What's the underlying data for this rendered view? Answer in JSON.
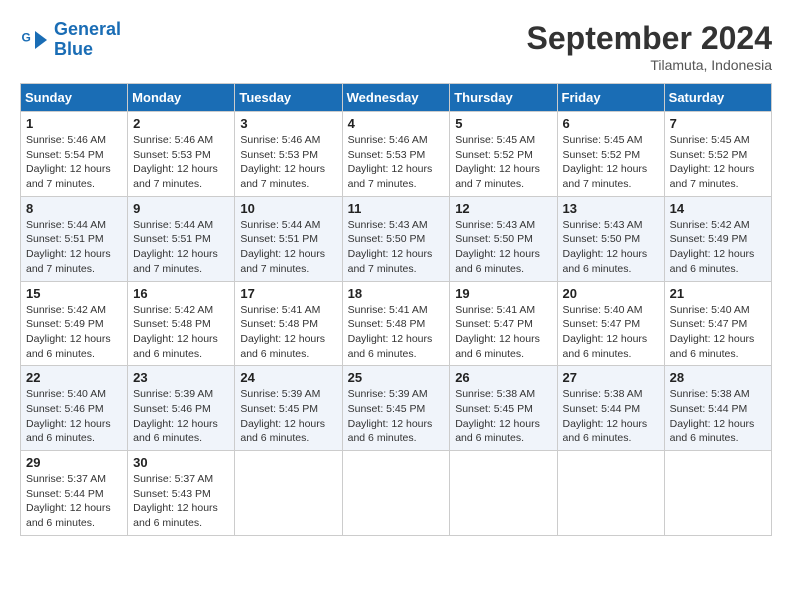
{
  "logo": {
    "line1": "General",
    "line2": "Blue"
  },
  "title": "September 2024",
  "subtitle": "Tilamuta, Indonesia",
  "headers": [
    "Sunday",
    "Monday",
    "Tuesday",
    "Wednesday",
    "Thursday",
    "Friday",
    "Saturday"
  ],
  "weeks": [
    [
      {
        "day": "1",
        "sunrise": "5:46 AM",
        "sunset": "5:54 PM",
        "daylight": "12 hours and 7 minutes."
      },
      {
        "day": "2",
        "sunrise": "5:46 AM",
        "sunset": "5:53 PM",
        "daylight": "12 hours and 7 minutes."
      },
      {
        "day": "3",
        "sunrise": "5:46 AM",
        "sunset": "5:53 PM",
        "daylight": "12 hours and 7 minutes."
      },
      {
        "day": "4",
        "sunrise": "5:46 AM",
        "sunset": "5:53 PM",
        "daylight": "12 hours and 7 minutes."
      },
      {
        "day": "5",
        "sunrise": "5:45 AM",
        "sunset": "5:52 PM",
        "daylight": "12 hours and 7 minutes."
      },
      {
        "day": "6",
        "sunrise": "5:45 AM",
        "sunset": "5:52 PM",
        "daylight": "12 hours and 7 minutes."
      },
      {
        "day": "7",
        "sunrise": "5:45 AM",
        "sunset": "5:52 PM",
        "daylight": "12 hours and 7 minutes."
      }
    ],
    [
      {
        "day": "8",
        "sunrise": "5:44 AM",
        "sunset": "5:51 PM",
        "daylight": "12 hours and 7 minutes."
      },
      {
        "day": "9",
        "sunrise": "5:44 AM",
        "sunset": "5:51 PM",
        "daylight": "12 hours and 7 minutes."
      },
      {
        "day": "10",
        "sunrise": "5:44 AM",
        "sunset": "5:51 PM",
        "daylight": "12 hours and 7 minutes."
      },
      {
        "day": "11",
        "sunrise": "5:43 AM",
        "sunset": "5:50 PM",
        "daylight": "12 hours and 7 minutes."
      },
      {
        "day": "12",
        "sunrise": "5:43 AM",
        "sunset": "5:50 PM",
        "daylight": "12 hours and 6 minutes."
      },
      {
        "day": "13",
        "sunrise": "5:43 AM",
        "sunset": "5:50 PM",
        "daylight": "12 hours and 6 minutes."
      },
      {
        "day": "14",
        "sunrise": "5:42 AM",
        "sunset": "5:49 PM",
        "daylight": "12 hours and 6 minutes."
      }
    ],
    [
      {
        "day": "15",
        "sunrise": "5:42 AM",
        "sunset": "5:49 PM",
        "daylight": "12 hours and 6 minutes."
      },
      {
        "day": "16",
        "sunrise": "5:42 AM",
        "sunset": "5:48 PM",
        "daylight": "12 hours and 6 minutes."
      },
      {
        "day": "17",
        "sunrise": "5:41 AM",
        "sunset": "5:48 PM",
        "daylight": "12 hours and 6 minutes."
      },
      {
        "day": "18",
        "sunrise": "5:41 AM",
        "sunset": "5:48 PM",
        "daylight": "12 hours and 6 minutes."
      },
      {
        "day": "19",
        "sunrise": "5:41 AM",
        "sunset": "5:47 PM",
        "daylight": "12 hours and 6 minutes."
      },
      {
        "day": "20",
        "sunrise": "5:40 AM",
        "sunset": "5:47 PM",
        "daylight": "12 hours and 6 minutes."
      },
      {
        "day": "21",
        "sunrise": "5:40 AM",
        "sunset": "5:47 PM",
        "daylight": "12 hours and 6 minutes."
      }
    ],
    [
      {
        "day": "22",
        "sunrise": "5:40 AM",
        "sunset": "5:46 PM",
        "daylight": "12 hours and 6 minutes."
      },
      {
        "day": "23",
        "sunrise": "5:39 AM",
        "sunset": "5:46 PM",
        "daylight": "12 hours and 6 minutes."
      },
      {
        "day": "24",
        "sunrise": "5:39 AM",
        "sunset": "5:45 PM",
        "daylight": "12 hours and 6 minutes."
      },
      {
        "day": "25",
        "sunrise": "5:39 AM",
        "sunset": "5:45 PM",
        "daylight": "12 hours and 6 minutes."
      },
      {
        "day": "26",
        "sunrise": "5:38 AM",
        "sunset": "5:45 PM",
        "daylight": "12 hours and 6 minutes."
      },
      {
        "day": "27",
        "sunrise": "5:38 AM",
        "sunset": "5:44 PM",
        "daylight": "12 hours and 6 minutes."
      },
      {
        "day": "28",
        "sunrise": "5:38 AM",
        "sunset": "5:44 PM",
        "daylight": "12 hours and 6 minutes."
      }
    ],
    [
      {
        "day": "29",
        "sunrise": "5:37 AM",
        "sunset": "5:44 PM",
        "daylight": "12 hours and 6 minutes."
      },
      {
        "day": "30",
        "sunrise": "5:37 AM",
        "sunset": "5:43 PM",
        "daylight": "12 hours and 6 minutes."
      },
      null,
      null,
      null,
      null,
      null
    ]
  ]
}
